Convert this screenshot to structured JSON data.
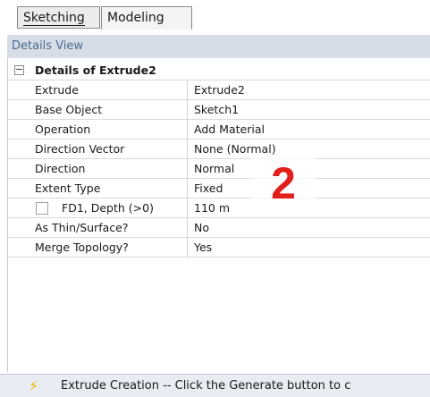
{
  "tabs": [
    {
      "label": "Sketching"
    },
    {
      "label": "Modeling"
    }
  ],
  "details_view": {
    "title": "Details View",
    "group_label": "Details of Extrude2",
    "rows": [
      {
        "name": "Extrude",
        "value": "Extrude2"
      },
      {
        "name": "Base Object",
        "value": "Sketch1"
      },
      {
        "name": "Operation",
        "value": "Add Material"
      },
      {
        "name": "Direction Vector",
        "value": "None (Normal)"
      },
      {
        "name": "Direction",
        "value": "Normal"
      },
      {
        "name": "Extent Type",
        "value": "Fixed"
      },
      {
        "name": "FD1,  Depth (>0)",
        "value": "110 m"
      },
      {
        "name": "As Thin/Surface?",
        "value": "No"
      },
      {
        "name": "Merge Topology?",
        "value": "Yes"
      }
    ]
  },
  "annotation": {
    "label": "2",
    "color": "#e0201a"
  },
  "status_bar": {
    "icon": "lightning-icon",
    "text": "Extrude Creation -- Click the Generate button to c"
  }
}
